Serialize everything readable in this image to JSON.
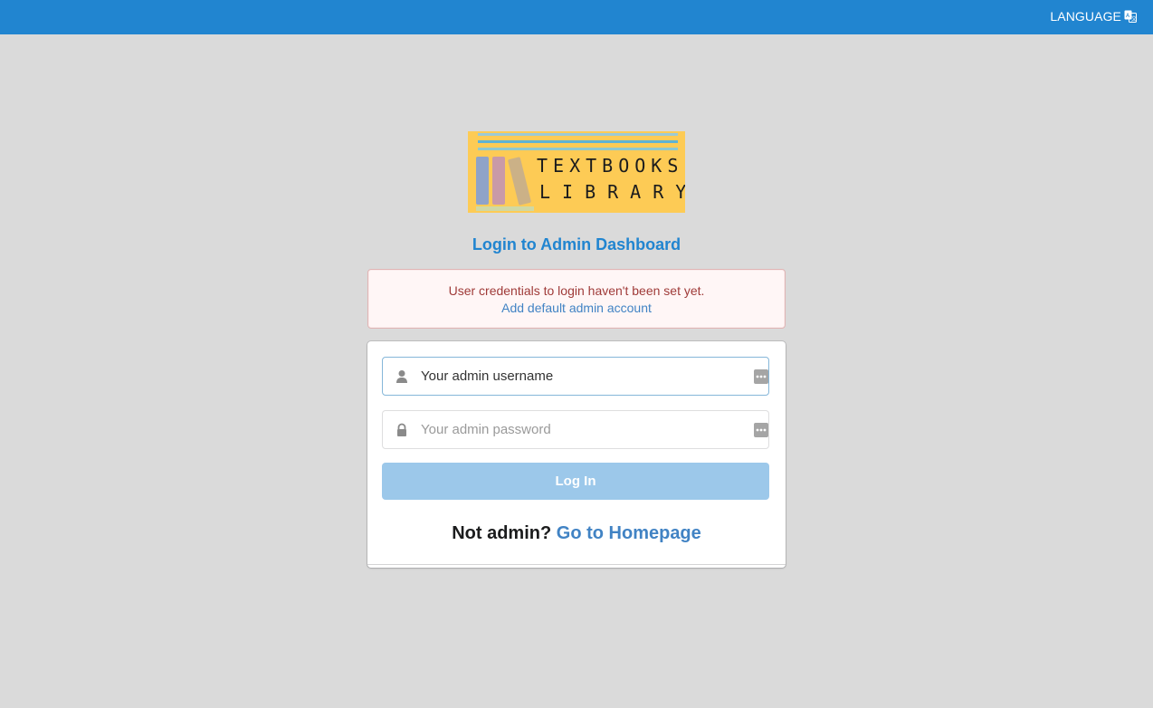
{
  "topbar": {
    "language_label": "LANGUAGE",
    "language_icon": "translate-icon",
    "color": "#2185d0"
  },
  "logo": {
    "line1": "TEXTBOOKS",
    "line2": "LIBRARY",
    "background": "#fdcb55"
  },
  "heading": "Login to Admin Dashboard",
  "alert": {
    "message": "User credentials to login haven't been set yet.",
    "link": "Add default admin account"
  },
  "form": {
    "username_placeholder": "Your admin username",
    "username_icon": "user-icon",
    "password_placeholder": "Your admin password",
    "password_icon": "lock-icon",
    "autofill_icon": "password-manager-icon",
    "login_label": "Log In"
  },
  "footer": {
    "question": "Not admin?",
    "link": "Go to Homepage"
  }
}
